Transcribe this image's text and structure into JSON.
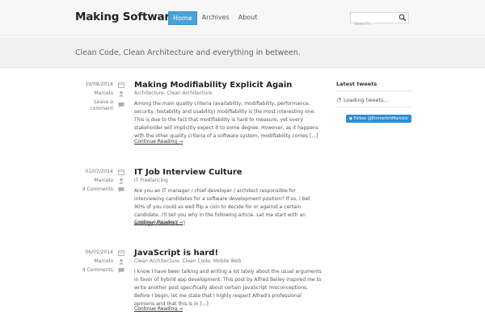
{
  "site": {
    "title": "Making Software",
    "tagline": "Clean Code, Clean Architecture and everything in between."
  },
  "nav": {
    "items": [
      {
        "label": "Home",
        "active": true
      },
      {
        "label": "Archives",
        "active": false
      },
      {
        "label": "About",
        "active": false
      }
    ]
  },
  "search": {
    "placeholder": "Search..."
  },
  "posts": [
    {
      "date": "19/08/2014",
      "author": "Marcelo",
      "comments": "Leave a comment",
      "title": "Making Modifiability Explicit Again",
      "categories": "Architecture, Clean Architecture",
      "excerpt": "Among the main quality criteria (availability, modifiability, performance, security, testability and usability) modifiability is the most interesting one. This is due to the fact that modifiability is hard to measure, yet every stakeholder will implicitly expect it to some degree. However, as it happens with the other quality criteria of a software system, modifiability comes [...]",
      "more": "Continue Reading →"
    },
    {
      "date": "01/07/2014",
      "author": "Marcelo",
      "comments": "4 Comments",
      "title": "IT Job Interview Culture",
      "categories": "IT Freelancing",
      "excerpt": "Are you an IT manager / chief developer / architect responsible for interviewing candidates for a software development position? If so, I bet 90% of you could as well flip a coin to decide for or against a certain candidate. I'll tell you why in the following article. Let me start with an analogy. Assume [...]",
      "more": "Continue Reading →"
    },
    {
      "date": "06/05/2014",
      "author": "Marcelo",
      "comments": "4 Comments",
      "title": "JavaScript is hard!",
      "categories": "Clean Architecture, Clean Code, Mobile Web",
      "excerpt": "I know I have been talking and writing a lot lately about the usual arguments in favor of hybrid app development. This post by Alfred Beiley inspired me to write another post specifically about certain JavaScript misconceptions. Before I begin, let me state that I highly respect Alfred's professional opinions and that this is in [...]",
      "more": "Continue Reading →"
    }
  ],
  "sidebar": {
    "widget_title": "Latest tweets",
    "loading_text": "Loading tweets...",
    "follow_label": "Follow @EmmerichMarcelo"
  },
  "colors": {
    "accent": "#4aa3d8",
    "twitter": "#2b8ed6"
  }
}
